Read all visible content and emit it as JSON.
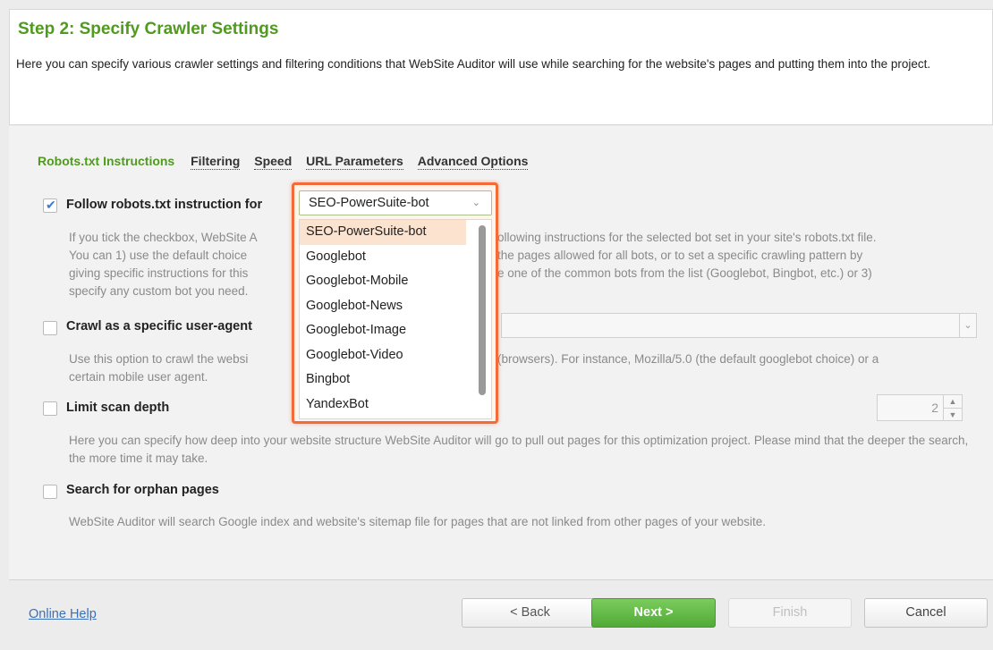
{
  "header": {
    "title": "Step 2: Specify Crawler Settings",
    "description": "Here you can specify various crawler settings and filtering conditions that WebSite Auditor will use while searching for the website's pages and putting them into the project."
  },
  "tabs": [
    "Robots.txt Instructions",
    "Filtering",
    "Speed",
    "URL Parameters",
    "Advanced Options"
  ],
  "options": {
    "robots": {
      "label": "Follow robots.txt instruction for",
      "checked": true,
      "help": [
        "If you tick the checkbox, WebSite A",
        "You can 1) use the default choice",
        "giving specific instructions for this",
        "specify any custom bot you need."
      ],
      "help_right": [
        "ollowing instructions for the selected bot set in your site's robots.txt file.",
        "the pages allowed for all bots, or to set a specific crawling pattern by",
        "e one of the common bots from the list (Googlebot, Bingbot, etc.) or 3)"
      ]
    },
    "useragent": {
      "label": "Crawl as a specific user-agent",
      "checked": false,
      "help": [
        "Use this option to crawl the websi",
        "certain mobile user agent."
      ],
      "help_right": "(browsers). For instance, Mozilla/5.0 (the default googlebot choice) or a"
    },
    "depth": {
      "label": "Limit scan depth",
      "checked": false,
      "value": "2",
      "help": "Here you can specify how deep into  your website structure WebSite Auditor will go to pull out pages for this optimization project. Please mind that the deeper the search, the more time it may take."
    },
    "orphan": {
      "label": "Search for orphan pages",
      "checked": false,
      "help": "WebSite Auditor will search Google index and website's sitemap file for pages that are not linked from other pages of your website."
    }
  },
  "bot_dropdown": {
    "selected": "SEO-PowerSuite-bot",
    "items": [
      "SEO-PowerSuite-bot",
      "Googlebot",
      "Googlebot-Mobile",
      "Googlebot-News",
      "Googlebot-Image",
      "Googlebot-Video",
      "Bingbot",
      "YandexBot"
    ]
  },
  "footer": {
    "help_link": "Online Help",
    "back": "< Back",
    "next": "Next >",
    "finish": "Finish",
    "cancel": "Cancel"
  },
  "colors": {
    "accent_green": "#4f9a1f",
    "highlight_orange": "#f26b38",
    "link_blue": "#3a70b8"
  }
}
